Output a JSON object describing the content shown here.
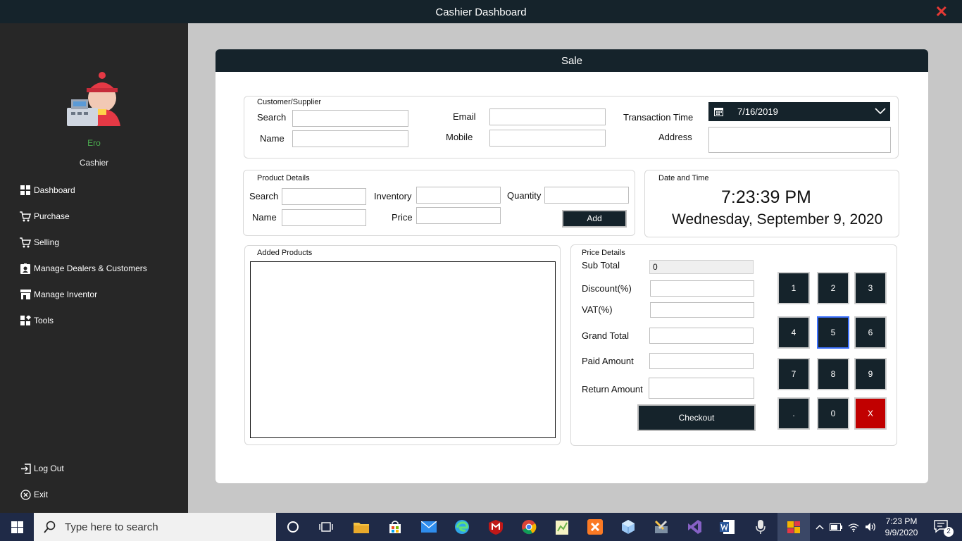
{
  "window": {
    "title": "Cashier Dashboard",
    "close_glyph": "✕"
  },
  "sidebar": {
    "user_name": "Ero",
    "user_role": "Cashier",
    "nav": [
      {
        "label": "Dashboard",
        "icon": "dashboard-icon"
      },
      {
        "label": "Purchase",
        "icon": "cart-icon"
      },
      {
        "label": "Selling",
        "icon": "cart-icon"
      },
      {
        "label": "Manage Dealers & Customers",
        "icon": "contact-badge-icon"
      },
      {
        "label": "Manage Inventor",
        "icon": "store-icon"
      },
      {
        "label": "Tools",
        "icon": "tools-icon"
      }
    ],
    "logout_label": "Log Out",
    "exit_label": "Exit"
  },
  "sale": {
    "header": "Sale",
    "customer": {
      "group_title": "Customer/Supplier",
      "search_label": "Search",
      "name_label": "Name",
      "email_label": "Email",
      "mobile_label": "Mobile",
      "transaction_time_label": "Transaction Time",
      "address_label": "Address",
      "transaction_date": "7/16/2019"
    },
    "product": {
      "group_title": "Product Details",
      "search_label": "Search",
      "name_label": "Name",
      "inventory_label": "Inventory",
      "price_label": "Price",
      "quantity_label": "Quantity",
      "add_label": "Add"
    },
    "datetime": {
      "group_title": "Date and Time",
      "time": "7:23:39 PM",
      "date": "Wednesday, September 9, 2020"
    },
    "added_products": {
      "group_title": "Added Products"
    },
    "price": {
      "group_title": "Price Details",
      "subtotal_label": "Sub Total",
      "subtotal_value": "0",
      "discount_label": "Discount(%)",
      "vat_label": "VAT(%)",
      "grand_total_label": "Grand Total",
      "paid_label": "Paid Amount",
      "return_label": "Return Amount",
      "checkout_label": "Checkout"
    },
    "keypad": [
      "1",
      "2",
      "3",
      "4",
      "5",
      "6",
      "7",
      "8",
      "9",
      ".",
      "0",
      "X"
    ]
  },
  "taskbar": {
    "search_placeholder": "Type here to search",
    "time": "7:23 PM",
    "date": "9/9/2020",
    "notification_count": "2"
  }
}
